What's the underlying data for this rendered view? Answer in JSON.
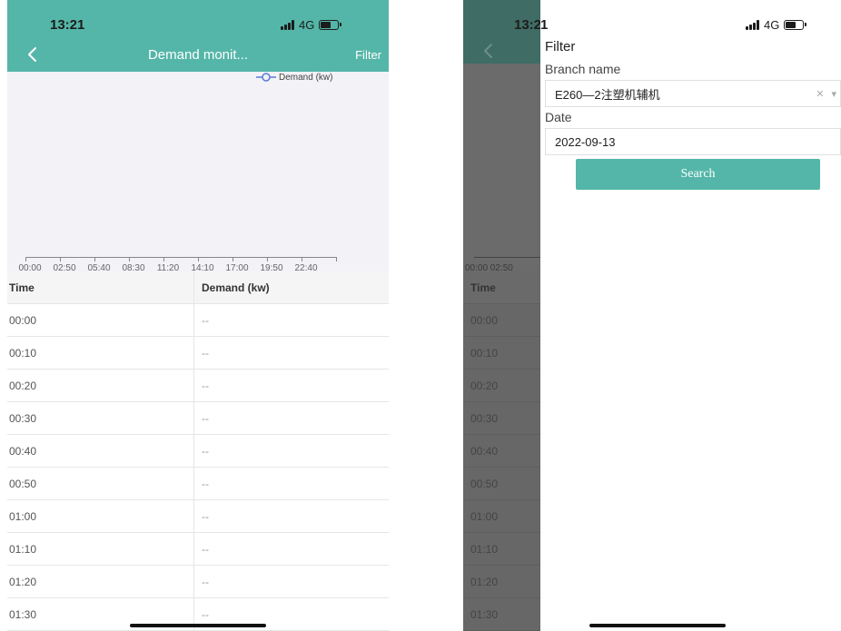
{
  "left": {
    "status": {
      "time": "13:21",
      "network": "4G"
    },
    "nav": {
      "title": "Demand monit...",
      "filter": "Filter"
    },
    "chart_data": {
      "type": "line",
      "title": "",
      "legend": [
        "Demand (kw)"
      ],
      "x_ticks": [
        "00:00",
        "02:50",
        "05:40",
        "08:30",
        "11:20",
        "14:10",
        "17:00",
        "19:50",
        "22:40"
      ],
      "series": [
        {
          "name": "Demand (kw)",
          "values": []
        }
      ]
    },
    "table": {
      "headers": [
        "Time",
        "Demand (kw)"
      ],
      "rows": [
        [
          "00:00",
          "--"
        ],
        [
          "00:10",
          "--"
        ],
        [
          "00:20",
          "--"
        ],
        [
          "00:30",
          "--"
        ],
        [
          "00:40",
          "--"
        ],
        [
          "00:50",
          "--"
        ],
        [
          "01:00",
          "--"
        ],
        [
          "01:10",
          "--"
        ],
        [
          "01:20",
          "--"
        ],
        [
          "01:30",
          "--"
        ]
      ]
    }
  },
  "right": {
    "status": {
      "time_prefix": "13:2",
      "time_suffix": "1",
      "network": "4G"
    },
    "background": {
      "ticks": "00:00 02:50",
      "header": "Time",
      "rows": [
        "00:00",
        "00:10",
        "00:20",
        "00:30",
        "00:40",
        "00:50",
        "01:00",
        "01:10",
        "01:20",
        "01:30"
      ]
    },
    "filter": {
      "title": "Filter",
      "branch_label": "Branch name",
      "branch_value": "E260—2注塑机辅机",
      "date_label": "Date",
      "date_value": "2022-09-13",
      "search": "Search"
    }
  },
  "colors": {
    "accent": "#54b6a8",
    "dim_overlay": "#6b6b6b"
  }
}
